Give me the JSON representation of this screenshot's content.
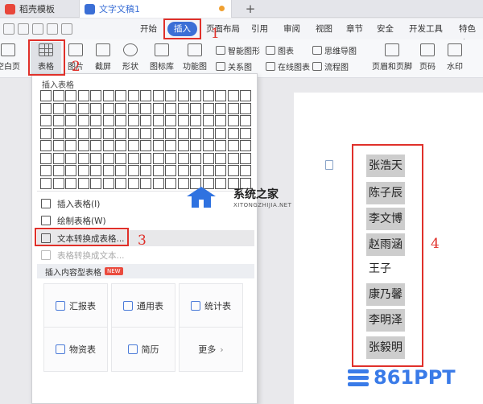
{
  "tabs": {
    "template_tab": "稻壳模板",
    "doc_tab": "文字文稿1",
    "new_tab": "+"
  },
  "menu": {
    "items": [
      "开始",
      "插入",
      "页面布局",
      "引用",
      "审阅",
      "视图",
      "章节",
      "安全",
      "开发工具",
      "特色功"
    ],
    "active": "插入"
  },
  "ribbon": {
    "blank_page": "空白页",
    "table": "表格",
    "picture": "图片",
    "screenshot": "截屏",
    "shape": "形状",
    "icon_lib": "图标库",
    "function_chart": "功能图",
    "smart_shape": "智能图形",
    "chart": "图表",
    "mind_map": "思维导图",
    "relation": "关系图",
    "online_chart": "在线图表",
    "flowchart": "流程图",
    "header_footer": "页眉和页脚",
    "page_num": "页码",
    "watermark": "水印"
  },
  "dropdown": {
    "heading": "插入表格",
    "insert_table": "插入表格(I)",
    "draw_table": "绘制表格(W)",
    "text_to_table": "文本转换成表格...",
    "table_to_text": "表格转换成文本...",
    "content_section": "插入内容型表格",
    "new_badge": "NEW",
    "cards": [
      "汇报表",
      "通用表",
      "统计表",
      "物资表",
      "简历",
      "更多"
    ]
  },
  "document": {
    "names": [
      "张浩天",
      "陈子辰",
      "李文博",
      "赵雨涵",
      "王子",
      "康乃馨",
      "李明泽",
      "张毅明"
    ]
  },
  "annotations": {
    "n1": "1",
    "n2": "2",
    "n3": "3",
    "n4": "4"
  },
  "watermarks": {
    "site_title": "系统之家",
    "site_sub": "XITONGZHIJIA.NET",
    "brand": "861PPT"
  }
}
